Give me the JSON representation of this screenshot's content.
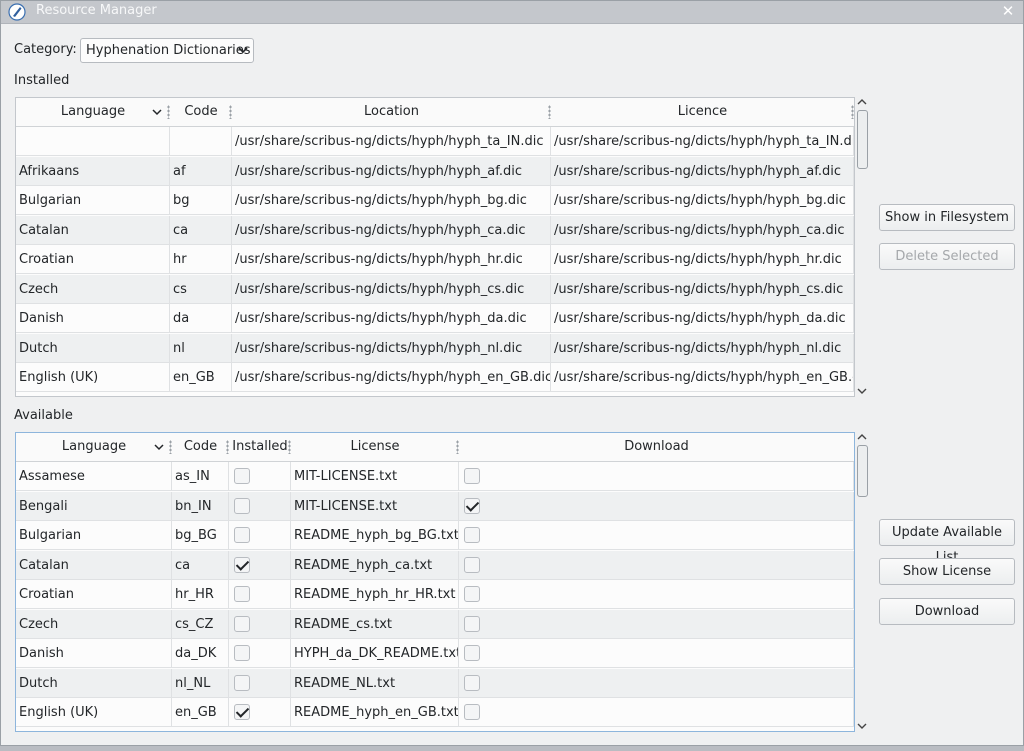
{
  "window": {
    "title": "Resource Manager"
  },
  "category": {
    "label": "Category:",
    "selected": "Hyphenation Dictionaries"
  },
  "installed": {
    "label": "Installed",
    "headers": {
      "language": "Language",
      "code": "Code",
      "location": "Location",
      "licence": "Licence"
    },
    "rows": [
      {
        "language": "",
        "code": "",
        "location": "/usr/share/scribus-ng/dicts/hyph/hyph_ta_IN.dic",
        "licence": "/usr/share/scribus-ng/dicts/hyph/hyph_ta_IN.dic"
      },
      {
        "language": "Afrikaans",
        "code": "af",
        "location": "/usr/share/scribus-ng/dicts/hyph/hyph_af.dic",
        "licence": "/usr/share/scribus-ng/dicts/hyph/hyph_af.dic"
      },
      {
        "language": "Bulgarian",
        "code": "bg",
        "location": "/usr/share/scribus-ng/dicts/hyph/hyph_bg.dic",
        "licence": "/usr/share/scribus-ng/dicts/hyph/hyph_bg.dic"
      },
      {
        "language": "Catalan",
        "code": "ca",
        "location": "/usr/share/scribus-ng/dicts/hyph/hyph_ca.dic",
        "licence": "/usr/share/scribus-ng/dicts/hyph/hyph_ca.dic"
      },
      {
        "language": "Croatian",
        "code": "hr",
        "location": "/usr/share/scribus-ng/dicts/hyph/hyph_hr.dic",
        "licence": "/usr/share/scribus-ng/dicts/hyph/hyph_hr.dic"
      },
      {
        "language": "Czech",
        "code": "cs",
        "location": "/usr/share/scribus-ng/dicts/hyph/hyph_cs.dic",
        "licence": "/usr/share/scribus-ng/dicts/hyph/hyph_cs.dic"
      },
      {
        "language": "Danish",
        "code": "da",
        "location": "/usr/share/scribus-ng/dicts/hyph/hyph_da.dic",
        "licence": "/usr/share/scribus-ng/dicts/hyph/hyph_da.dic"
      },
      {
        "language": "Dutch",
        "code": "nl",
        "location": "/usr/share/scribus-ng/dicts/hyph/hyph_nl.dic",
        "licence": "/usr/share/scribus-ng/dicts/hyph/hyph_nl.dic"
      },
      {
        "language": "English (UK)",
        "code": "en_GB",
        "location": "/usr/share/scribus-ng/dicts/hyph/hyph_en_GB.dic",
        "licence": "/usr/share/scribus-ng/dicts/hyph/hyph_en_GB.dic"
      }
    ],
    "buttons": {
      "show_in_filesystem": "Show in Filesystem",
      "delete_selected": "Delete Selected"
    }
  },
  "available": {
    "label": "Available",
    "headers": {
      "language": "Language",
      "code": "Code",
      "installed": "Installed",
      "license": "License",
      "download": "Download"
    },
    "rows": [
      {
        "language": "Assamese",
        "code": "as_IN",
        "installed": false,
        "license": "MIT-LICENSE.txt",
        "download": false
      },
      {
        "language": "Bengali",
        "code": "bn_IN",
        "installed": false,
        "license": "MIT-LICENSE.txt",
        "download": true
      },
      {
        "language": "Bulgarian",
        "code": "bg_BG",
        "installed": false,
        "license": "README_hyph_bg_BG.txt",
        "download": false
      },
      {
        "language": "Catalan",
        "code": "ca",
        "installed": true,
        "license": "README_hyph_ca.txt",
        "download": false
      },
      {
        "language": "Croatian",
        "code": "hr_HR",
        "installed": false,
        "license": "README_hyph_hr_HR.txt",
        "download": false
      },
      {
        "language": "Czech",
        "code": "cs_CZ",
        "installed": false,
        "license": "README_cs.txt",
        "download": false
      },
      {
        "language": "Danish",
        "code": "da_DK",
        "installed": false,
        "license": "HYPH_da_DK_README.txt",
        "download": false
      },
      {
        "language": "Dutch",
        "code": "nl_NL",
        "installed": false,
        "license": "README_NL.txt",
        "download": false
      },
      {
        "language": "English (UK)",
        "code": "en_GB",
        "installed": true,
        "license": "README_hyph_en_GB.txt",
        "download": false
      }
    ],
    "buttons": {
      "update_available_list": "Update Available List",
      "show_license": "Show License",
      "download": "Download"
    }
  },
  "icons": {
    "app": "scribus-app-icon",
    "close": "close-icon",
    "dropdown": "chevron-down-icon",
    "scroll_up": "chevron-up-icon",
    "scroll_down": "chevron-down-icon"
  }
}
